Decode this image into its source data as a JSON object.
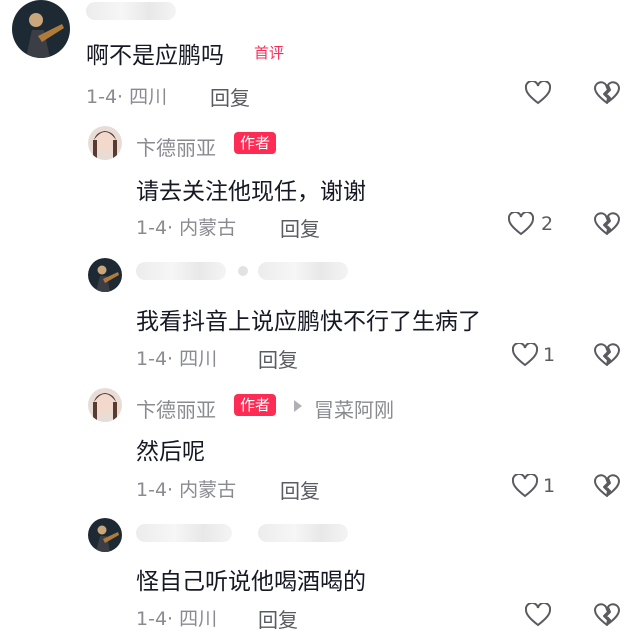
{
  "comments": [
    {
      "text": "啊不是应鹏吗",
      "badge": "首评",
      "date": "1-4·",
      "location": "四川",
      "reply": "回复"
    },
    {
      "author": "卞德丽亚",
      "badge": "作者",
      "text": "请去关注他现任，谢谢",
      "date": "1-4·",
      "location": "内蒙古",
      "reply": "回复",
      "likes": "2"
    },
    {
      "text": "我看抖音上说应鹏快不行了生病了",
      "date": "1-4·",
      "location": "四川",
      "reply": "回复",
      "likes": "1"
    },
    {
      "author": "卞德丽亚",
      "badge": "作者",
      "reply_to": "冒菜阿刚",
      "text": "然后呢",
      "date": "1-4·",
      "location": "内蒙古",
      "reply": "回复",
      "likes": "1"
    },
    {
      "text": "怪自己听说他喝酒喝的",
      "date": "1-4·",
      "location": "四川",
      "reply": "回复"
    }
  ],
  "colors": {
    "accent": "#fe2c55",
    "muted": "#8a8b91",
    "text": "#161823"
  },
  "icons": {
    "like": "heart-outline-icon",
    "dislike": "broken-heart-icon",
    "reply_arrow": "triangle-right-icon"
  }
}
